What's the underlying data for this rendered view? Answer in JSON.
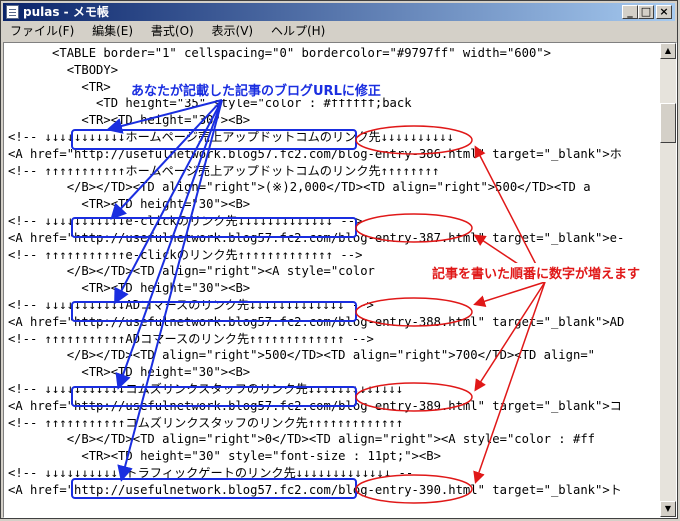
{
  "window": {
    "title": "pulas - メモ帳",
    "minimize_label": "_",
    "maximize_label": "□",
    "close_label": "×"
  },
  "menu": {
    "items": [
      "ファイル(F)",
      "編集(E)",
      "書式(O)",
      "表示(V)",
      "ヘルプ(H)"
    ]
  },
  "editor": {
    "lines": [
      "      <TABLE border=\"1\" cellspacing=\"0\" bordercolor=\"#9797ff\" width=\"600\">",
      "        <TBODY>",
      "          <TR>",
      "            <TD height=\"35\" style=\"color : #ffffff;back",
      "          <TR><TD height=\"30\"><B>",
      "<!-- ↓↓↓↓↓↓↓↓↓↓↓ホームページ売上アップドットコムのリンク先↓↓↓↓↓↓↓↓↓↓",
      "<A href=\"http://usefulnetwork.blog57.fc2.com/blog-entry-386.html\" target=\"_blank\">ホ",
      "<!-- ↑↑↑↑↑↑↑↑↑↑↑ホームページ売上アップドットコムのリンク先↑↑↑↑↑↑↑↑",
      "        </B></TD><TD align=\"right\">(※)2,000</TD><TD align=\"right\">500</TD><TD a",
      "          <TR><TD height=\"30\"><B>",
      "<!-- ↓↓↓↓↓↓↓↓↓↓↓e-clickのリンク先↓↓↓↓↓↓↓↓↓↓↓↓↓ -->",
      "<A href=\"http://usefulnetwork.blog57.fc2.com/blog-entry-387.html\" target=\"_blank\">e-",
      "<!-- ↑↑↑↑↑↑↑↑↑↑↑e-clickのリンク先↑↑↑↑↑↑↑↑↑↑↑↑↑ -->",
      "        </B></TD><TD align=\"right\"><A style=\"color",
      "          <TR><TD height=\"30\"><B>",
      "<!-- ↓↓↓↓↓↓↓↓↓↓↓ADコマースのリンク先↓↓↓↓↓↓↓↓↓↓↓↓↓ -->",
      "<A href=\"http://usefulnetwork.blog57.fc2.com/blog-entry-388.html\" target=\"_blank\">AD",
      "<!-- ↑↑↑↑↑↑↑↑↑↑↑ADコマースのリンク先↑↑↑↑↑↑↑↑↑↑↑↑↑ -->",
      "        </B></TD><TD align=\"right\">500</TD><TD align=\"right\">700</TD><TD align=\"",
      "          <TR><TD height=\"30\"><B>",
      "<!-- ↓↓↓↓↓↓↓↓↓↓↓コムズリンクスタッフのリンク先↓↓↓↓↓↓↓↓↓↓↓↓↓",
      "<A href=\"http://usefulnetwork.blog57.fc2.com/blog-entry-389.html\" target=\"_blank\">コ",
      "<!-- ↑↑↑↑↑↑↑↑↑↑↑コムズリンクスタッフのリンク先↑↑↑↑↑↑↑↑↑↑↑↑↑",
      "        </B></TD><TD align=\"right\">0</TD><TD align=\"right\"><A style=\"color : #ff",
      "          <TR><TD height=\"30\" style=\"font-size : 11pt;\"><B>",
      "<!-- ↓↓↓↓↓↓↓↓↓↓↓トラフィックゲートのリンク先↓↓↓↓↓↓↓↓↓↓↓↓↓ --",
      "<A href=\"http://usefulnetwork.blog57.fc2.com/blog-entry-390.html\" target=\"_blank\">ト"
    ]
  },
  "annotations": {
    "blue_note": "あなたが記載した記事のブログURLに修正",
    "red_note": "記事を書いた順番に数字が増えます",
    "blue_color": "#1a2ee0",
    "red_color": "#e01818"
  }
}
